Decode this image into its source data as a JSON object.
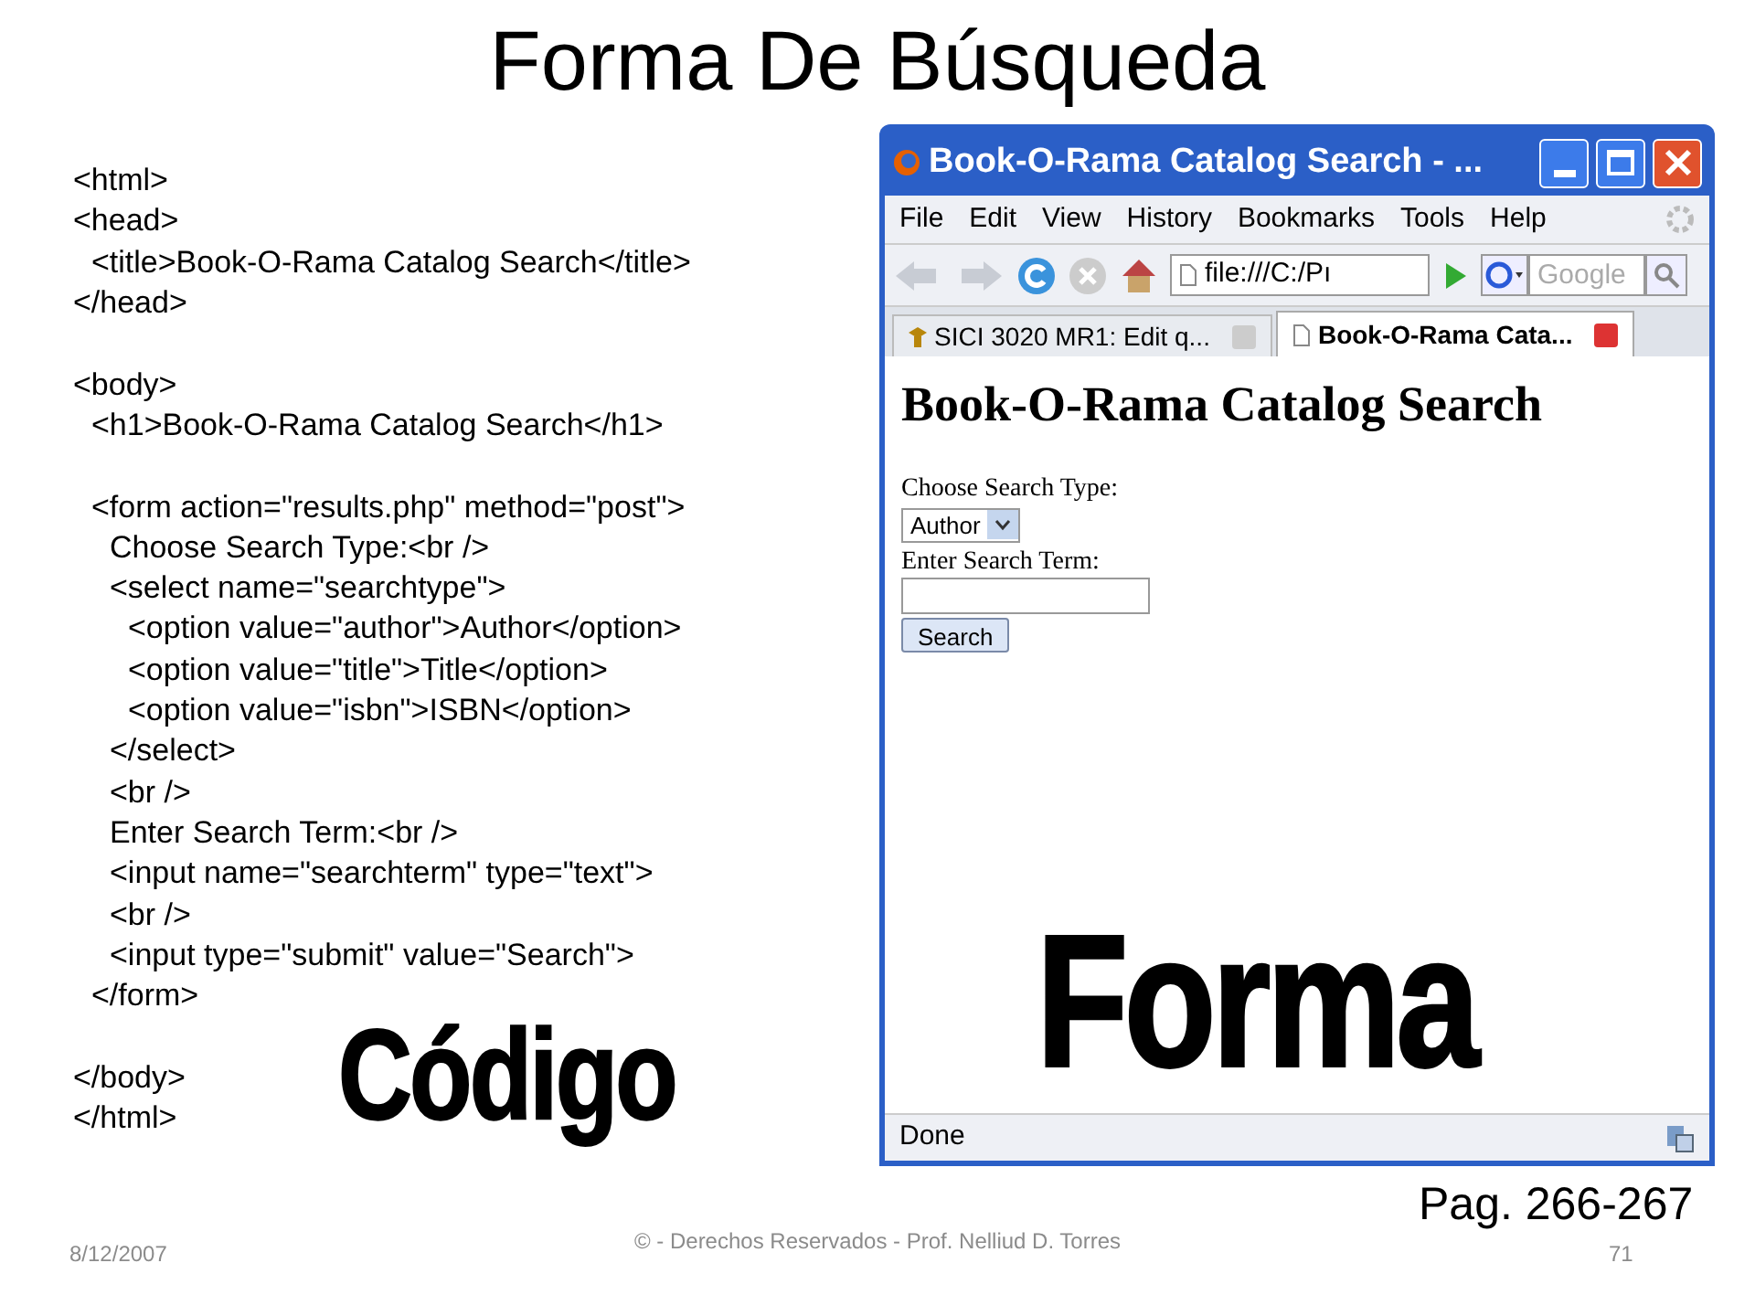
{
  "slide_title": "Forma De Búsqueda",
  "code_lines": [
    {
      "text": "<html>"
    },
    {
      "text": "<head>",
      "children": [
        {
          "text": "<title>Book-O-Rama Catalog Search</title>"
        }
      ]
    },
    {
      "text": "</head>"
    },
    {
      "text": "<body>",
      "gap_before": true,
      "children": [
        {
          "text": "<h1>Book-O-Rama Catalog Search</h1>"
        },
        {
          "text": "<form action=\"results.php\" method=\"post\">",
          "gap_before": true,
          "children": [
            {
              "text": "Choose Search Type:<br />"
            },
            {
              "text": "<select name=\"searchtype\">",
              "children": [
                {
                  "text": "<option value=\"author\">Author</option>"
                },
                {
                  "text": "<option value=\"title\">Title</option>"
                },
                {
                  "text": "<option value=\"isbn\">ISBN</option>"
                }
              ]
            },
            {
              "text": "</select>"
            },
            {
              "text": "<br />"
            },
            {
              "text": "Enter Search Term:<br />"
            },
            {
              "text": "<input name=\"searchterm\" type=\"text\">"
            },
            {
              "text": "<br />"
            },
            {
              "text": "<input type=\"submit\" value=\"Search\">"
            }
          ]
        },
        {
          "text": "</form>"
        }
      ]
    },
    {
      "text": "</body>",
      "gap_before": true
    },
    {
      "text": "</html>"
    }
  ],
  "code_caption": "Código",
  "form_caption": "Forma",
  "browser": {
    "title": "Book-O-Rama Catalog Search - ...",
    "menu": [
      "File",
      "Edit",
      "View",
      "History",
      "Bookmarks",
      "Tools",
      "Help"
    ],
    "address": "file:///C:/Pı",
    "search_placeholder": "Google",
    "tabs": [
      {
        "label": "SICI 3020 MR1: Edit q...",
        "selected": false
      },
      {
        "label": "Book-O-Rama Cata...",
        "selected": true
      }
    ],
    "page": {
      "heading": "Book-O-Rama Catalog Search",
      "type_label": "Choose Search Type:",
      "select_value": "Author",
      "term_label": "Enter Search Term:",
      "button": "Search"
    },
    "status": "Done"
  },
  "pages_ref": "Pag. 266-267",
  "footer": {
    "date": "8/12/2007",
    "copyright": "© - Derechos Reservados  - Prof. Nelliud D. Torres",
    "number": "71"
  }
}
